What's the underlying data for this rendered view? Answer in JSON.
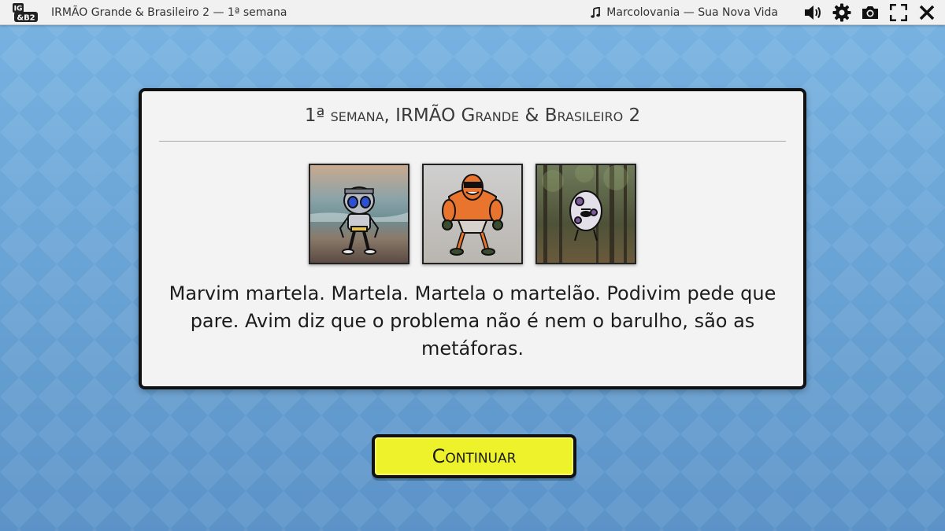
{
  "window": {
    "title": "IRMÃO Grande & Brasileiro 2 — 1ª semana",
    "logo_text": "IG&B2"
  },
  "music": {
    "icon": "music-note-icon",
    "track": "Marcolovania — Sua Nova Vida"
  },
  "toolbar": {
    "icons": [
      "volume-icon",
      "gear-icon",
      "camera-icon",
      "fullscreen-icon",
      "close-icon"
    ]
  },
  "dialog": {
    "title": "1ª semana, IRMÃO Grande & Brasileiro 2",
    "portraits": [
      {
        "name": "robot-alien-portrait",
        "scene": "beach"
      },
      {
        "name": "muscle-man-portrait",
        "scene": "sand"
      },
      {
        "name": "egg-creature-portrait",
        "scene": "forest"
      }
    ],
    "message": "Marvim martela. Martela. Martela o martelão. Podivim pede que pare. Avim diz que o problema não é nem o barulho, são as metáforas."
  },
  "continue_button": {
    "label": "Continuar"
  },
  "colors": {
    "background": "#6aa3d6",
    "dialog": "#f3f3f3",
    "button": "#eef22a",
    "border": "#111111"
  }
}
